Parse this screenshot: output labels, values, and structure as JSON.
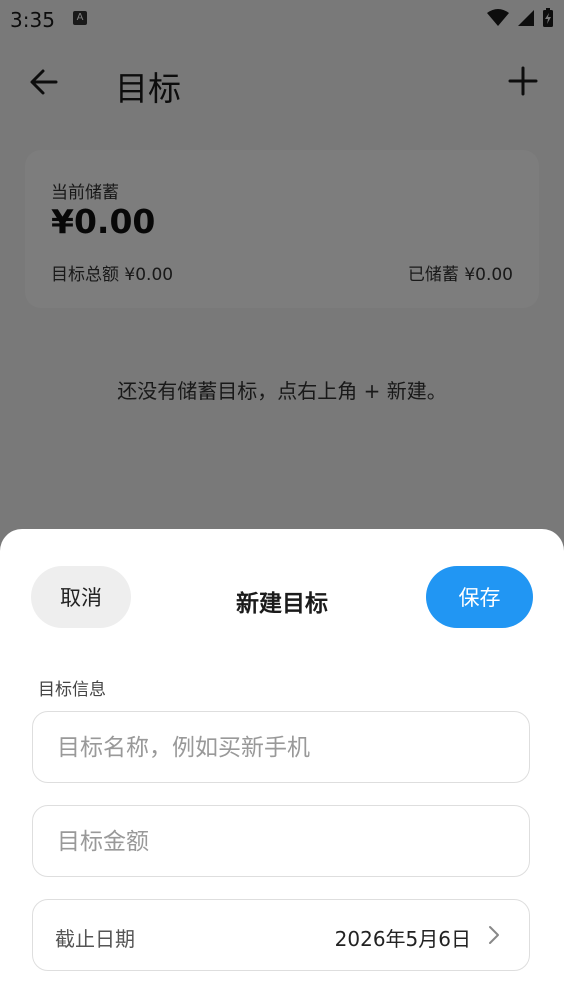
{
  "status_bar": {
    "time": "3:35",
    "badge": "A",
    "icons": [
      "wifi-icon",
      "signal-icon",
      "battery-charging-icon"
    ]
  },
  "app_bar": {
    "title": "目标",
    "back_icon": "arrow-left-icon",
    "add_icon": "plus-icon"
  },
  "summary": {
    "current_label": "当前储蓄",
    "current_amount": "¥0.00",
    "total_label": "目标总额 ¥0.00",
    "saved_label": "已储蓄 ¥0.00"
  },
  "empty_message": "还没有储蓄目标，点右上角 + 新建。",
  "sheet": {
    "cancel_label": "取消",
    "title": "新建目标",
    "save_label": "保存",
    "section_label": "目标信息",
    "name_placeholder": "目标名称，例如买新手机",
    "name_value": "",
    "amount_placeholder": "目标金额",
    "amount_value": "",
    "deadline_label": "截止日期",
    "deadline_value": "2026年5月6日"
  },
  "colors": {
    "accent": "#2196f3",
    "scrim": "rgba(0,0,0,0.5)",
    "sheet_bg": "#ffffff"
  }
}
